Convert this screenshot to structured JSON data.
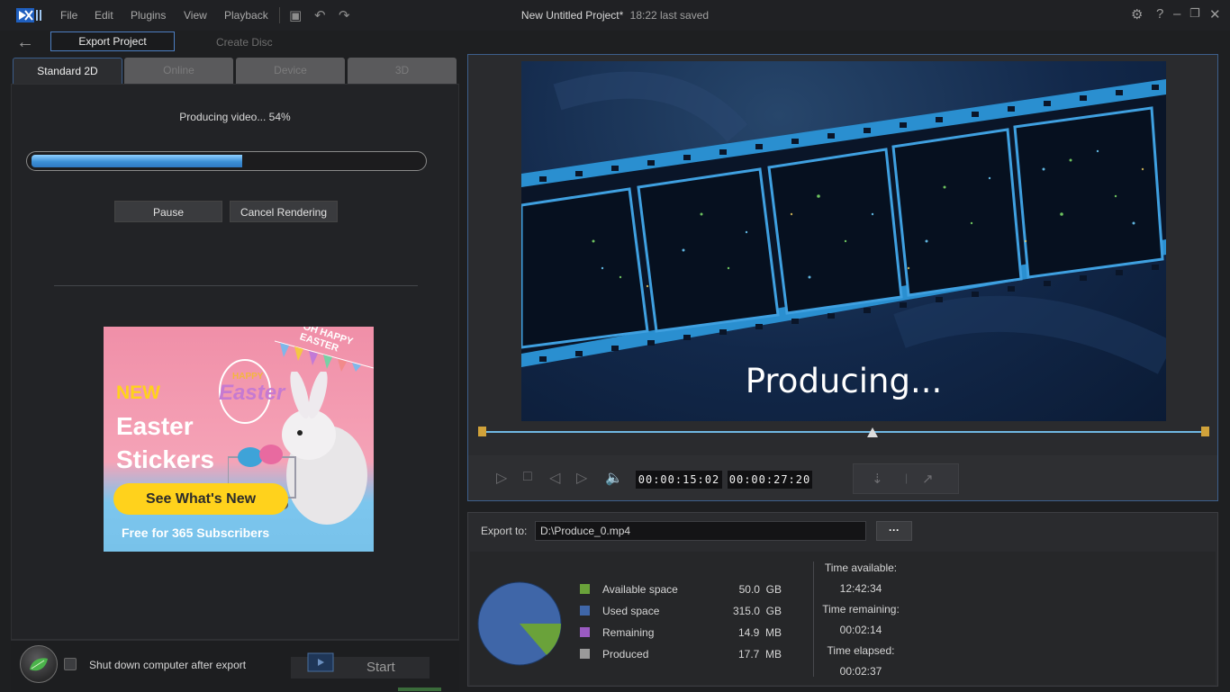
{
  "titlebar": {
    "menu": [
      "File",
      "Edit",
      "Plugins",
      "View",
      "Playback"
    ],
    "project_title": "New Untitled Project*",
    "saved_status": "18:22 last saved"
  },
  "nav": {
    "export_project": "Export Project",
    "create_disc": "Create Disc"
  },
  "tabs": [
    {
      "label": "Standard 2D",
      "active": true
    },
    {
      "label": "Online",
      "active": false
    },
    {
      "label": "Device",
      "active": false
    },
    {
      "label": "3D",
      "active": false
    }
  ],
  "progress": {
    "label": "Producing video... 54%",
    "percent": 54
  },
  "buttons": {
    "pause": "Pause",
    "cancel": "Cancel Rendering",
    "start": "Start"
  },
  "ad": {
    "corner_text": "OH HAPPY EASTER",
    "badge_happy": "HAPPY",
    "badge_easter": "Easter",
    "new_label": "NEW",
    "title_line1": "Easter",
    "title_line2": "Stickers",
    "cta": "See What's New",
    "subtitle": "Free for 365 Subscribers"
  },
  "shutdown_label": "Shut down computer after export",
  "preview": {
    "overlay_text": "Producing...",
    "timecode_current": "00:00:15:02",
    "timecode_total": "00:00:27:20",
    "playhead_fraction": 0.54
  },
  "export": {
    "label": "Export to:",
    "path": "D:\\Produce_0.mp4",
    "browse": "···"
  },
  "disk": {
    "legend": [
      {
        "label": "Available space",
        "value": "50.0",
        "unit": "GB",
        "color": "#6aa23a"
      },
      {
        "label": "Used space",
        "value": "315.0",
        "unit": "GB",
        "color": "#3f66a8"
      },
      {
        "label": "Remaining",
        "value": "14.9",
        "unit": "MB",
        "color": "#9b5bc2"
      },
      {
        "label": "Produced",
        "value": "17.7",
        "unit": "MB",
        "color": "#9a9a9a"
      }
    ]
  },
  "times": {
    "available_label": "Time available:",
    "available": "12:42:34",
    "remaining_label": "Time remaining:",
    "remaining": "00:02:14",
    "elapsed_label": "Time elapsed:",
    "elapsed": "00:02:37"
  },
  "colors": {
    "accent_blue": "#3d5f8c",
    "progress_fill": "#3c8fd6",
    "ad_yellow": "#ffd21c"
  }
}
